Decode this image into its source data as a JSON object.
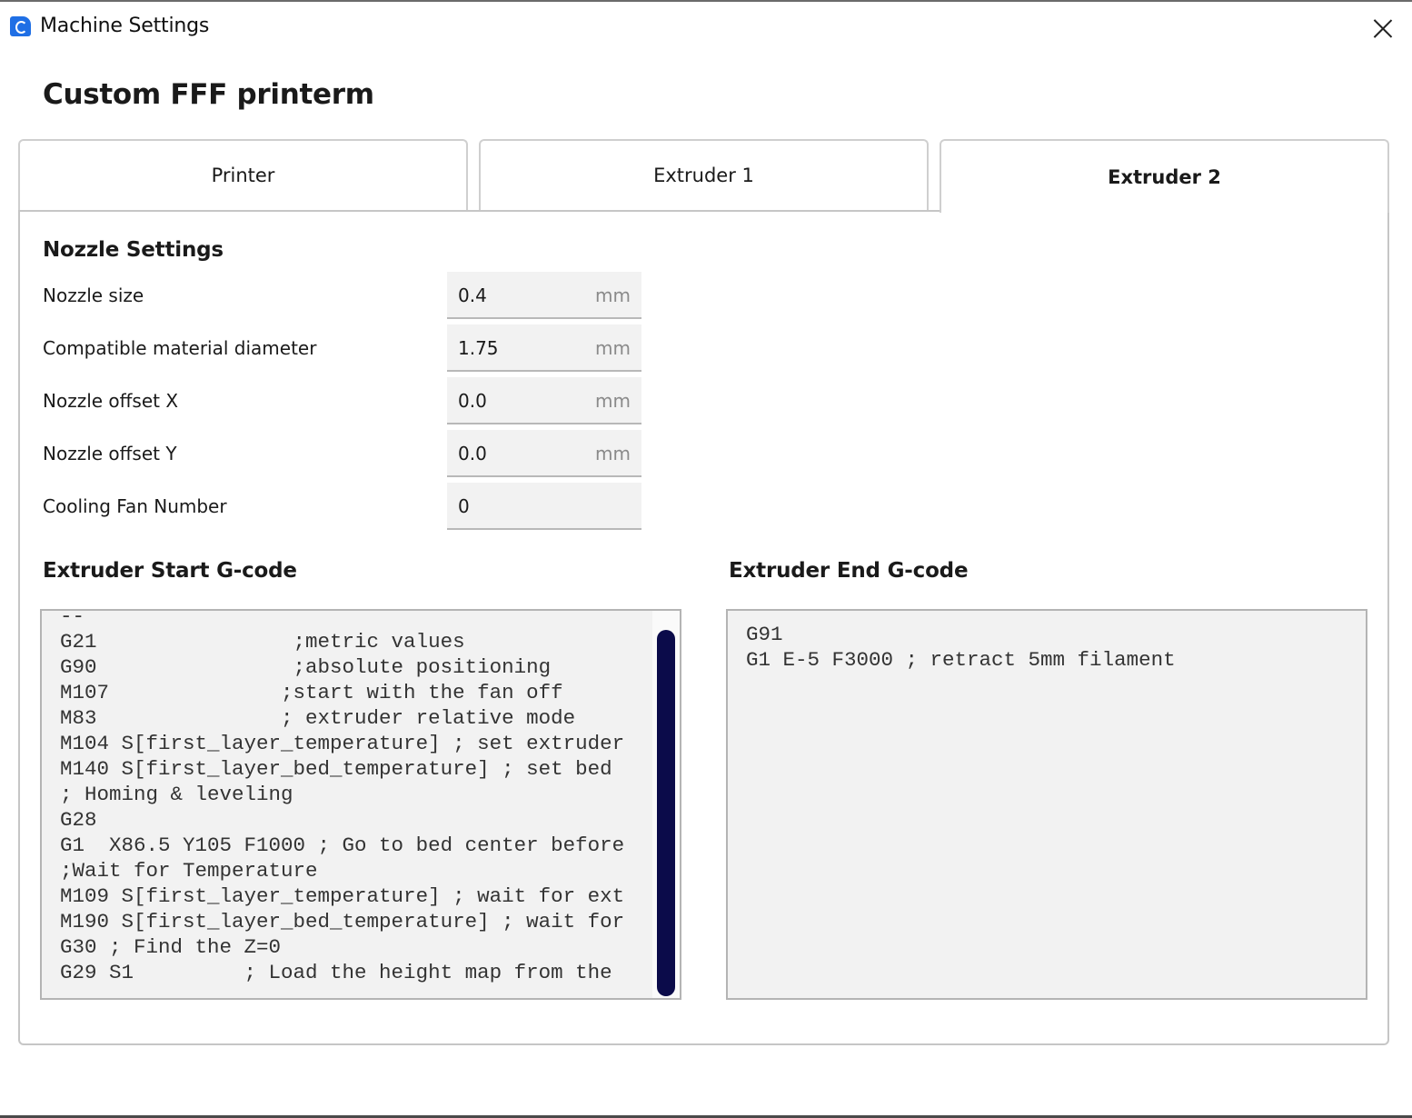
{
  "window": {
    "title": "Machine Settings",
    "app_icon": "cura-logo-icon",
    "close_icon": "close-icon"
  },
  "machine_name": "Custom FFF printerm",
  "tabs": [
    {
      "label": "Printer",
      "active": false
    },
    {
      "label": "Extruder 1",
      "active": false
    },
    {
      "label": "Extruder 2",
      "active": true
    }
  ],
  "nozzle_settings": {
    "title": "Nozzle Settings",
    "fields": [
      {
        "label": "Nozzle size",
        "value": "0.4",
        "unit": "mm"
      },
      {
        "label": "Compatible material diameter",
        "value": "1.75",
        "unit": "mm"
      },
      {
        "label": "Nozzle offset X",
        "value": "0.0",
        "unit": "mm"
      },
      {
        "label": "Nozzle offset Y",
        "value": "0.0",
        "unit": "mm"
      },
      {
        "label": "Cooling Fan Number",
        "value": "0",
        "unit": ""
      }
    ]
  },
  "start_gcode": {
    "title": "Extruder Start G-code",
    "lines": [
      "--",
      "G21                ;metric values",
      "G90                ;absolute positioning",
      "M107              ;start with the fan off",
      "M83               ; extruder relative mode",
      "M104 S[first_layer_temperature] ; set extruder",
      "M140 S[first_layer_bed_temperature] ; set bed",
      "; Homing & leveling",
      "G28",
      "G1  X86.5 Y105 F1000 ; Go to bed center before",
      ";Wait for Temperature",
      "M109 S[first_layer_temperature] ; wait for ext",
      "M190 S[first_layer_bed_temperature] ; wait for",
      "G30 ; Find the Z=0",
      "G29 S1         ; Load the height map from the"
    ]
  },
  "end_gcode": {
    "title": "Extruder End G-code",
    "lines": [
      "G91",
      "G1 E-5 F3000 ; retract 5mm filament"
    ]
  },
  "colors": {
    "accent": "#1f6fe5",
    "scrollbar_thumb": "#0b0b4a",
    "field_background": "#f2f2f2"
  }
}
